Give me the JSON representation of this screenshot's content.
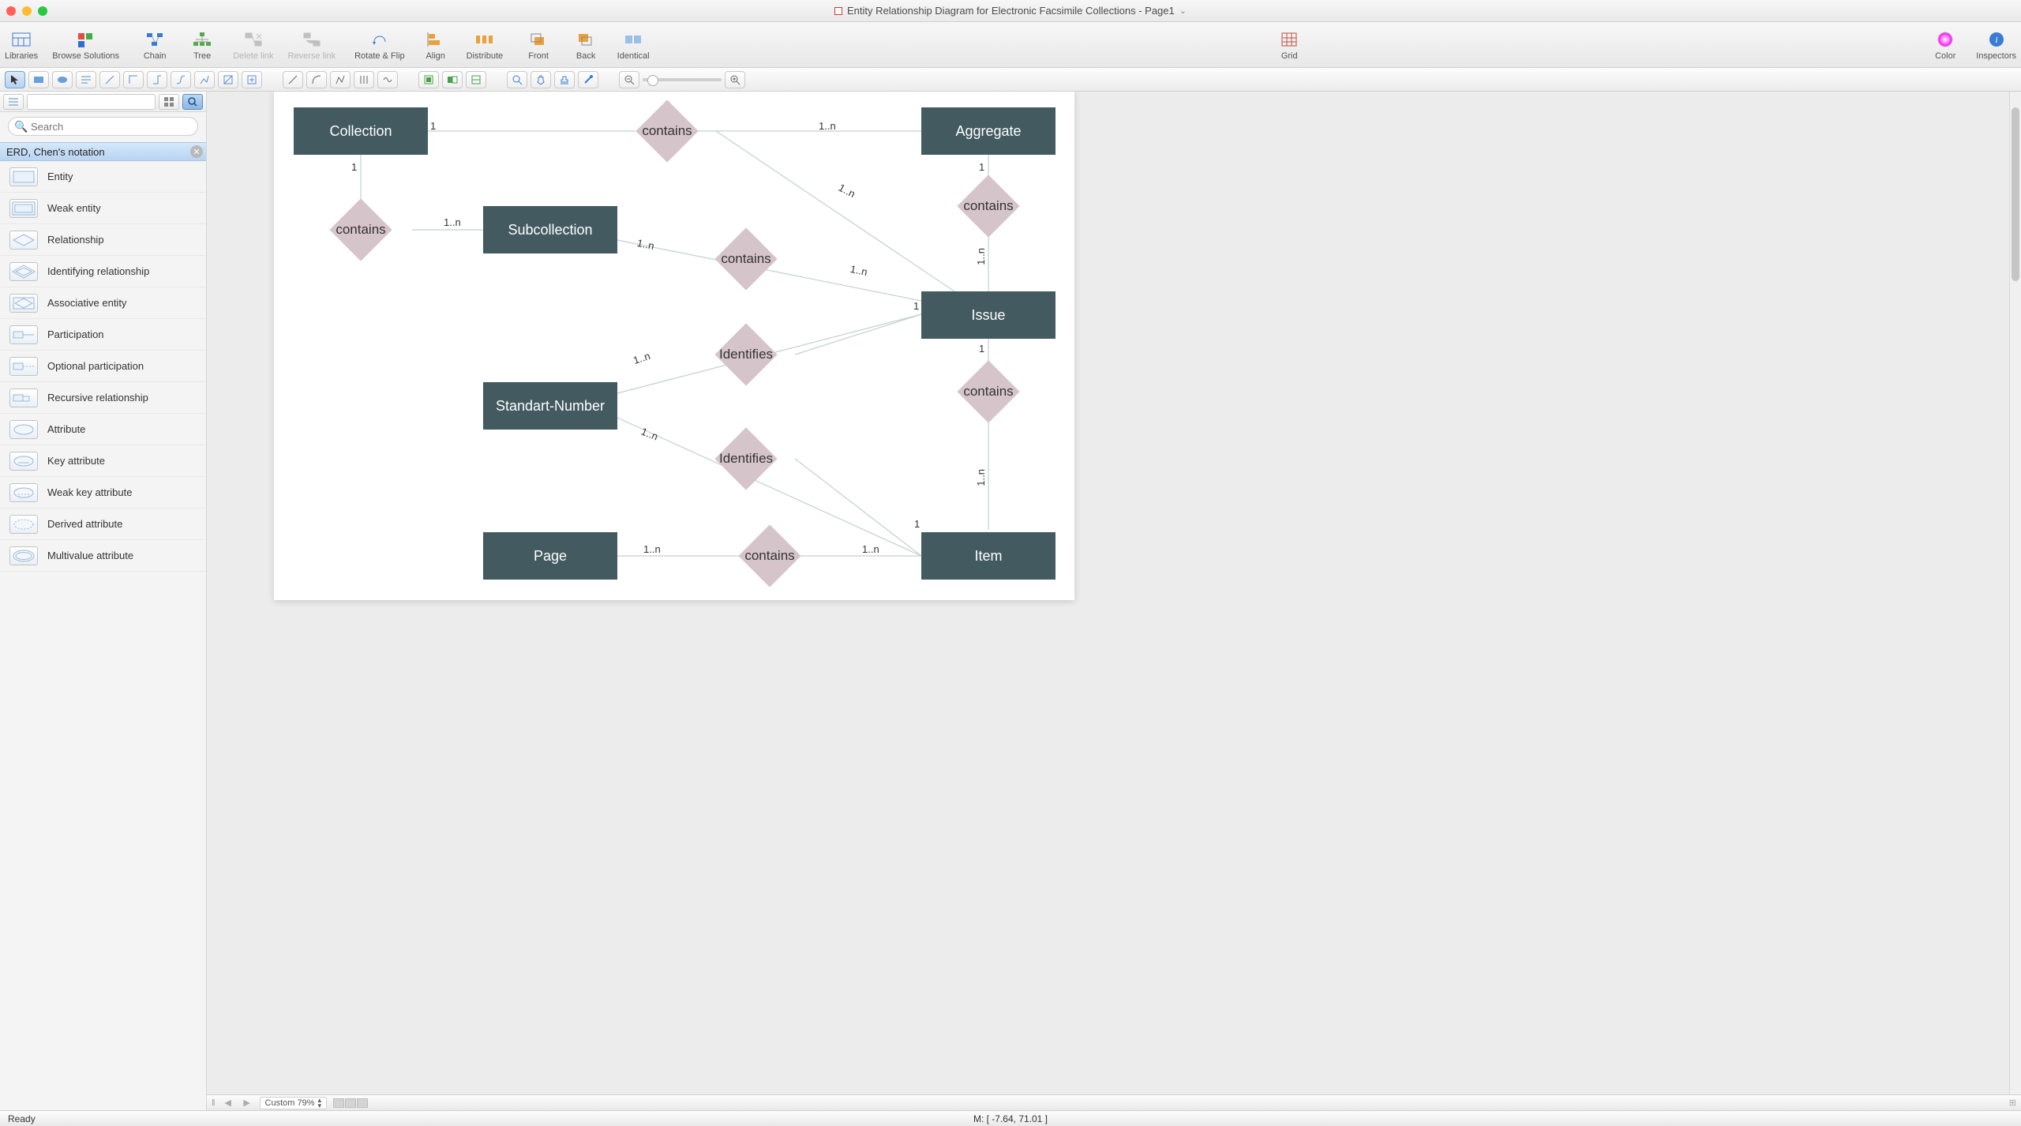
{
  "title": "Entity Relationship Diagram for Electronic Facsimile Collections - Page1",
  "toolbar": {
    "libraries": "Libraries",
    "browse": "Browse Solutions",
    "chain": "Chain",
    "tree": "Tree",
    "delete_link": "Delete link",
    "reverse_link": "Reverse link",
    "rotate_flip": "Rotate & Flip",
    "align": "Align",
    "distribute": "Distribute",
    "front": "Front",
    "back": "Back",
    "identical": "Identical",
    "grid": "Grid",
    "color": "Color",
    "inspectors": "Inspectors"
  },
  "sidebar": {
    "search_placeholder": "Search",
    "library_title": "ERD, Chen's notation",
    "items": [
      "Entity",
      "Weak entity",
      "Relationship",
      "Identifying relationship",
      "Associative entity",
      "Participation",
      "Optional participation",
      "Recursive relationship",
      "Attribute",
      "Key attribute",
      "Weak key attribute",
      "Derived attribute",
      "Multivalue attribute"
    ]
  },
  "diagram": {
    "entities": {
      "collection": "Collection",
      "subcollection": "Subcollection",
      "aggregate": "Aggregate",
      "issue": "Issue",
      "standart_number": "Standart-Number",
      "item": "Item",
      "page": "Page"
    },
    "rel": {
      "contains": "contains",
      "identifies": "Identifies"
    },
    "card": {
      "one": "1",
      "one_n": "1..n"
    }
  },
  "bottombar": {
    "zoom_label": "Custom 79%"
  },
  "status": {
    "ready": "Ready",
    "mouse": "M: [ -7.64, 71.01 ]"
  }
}
